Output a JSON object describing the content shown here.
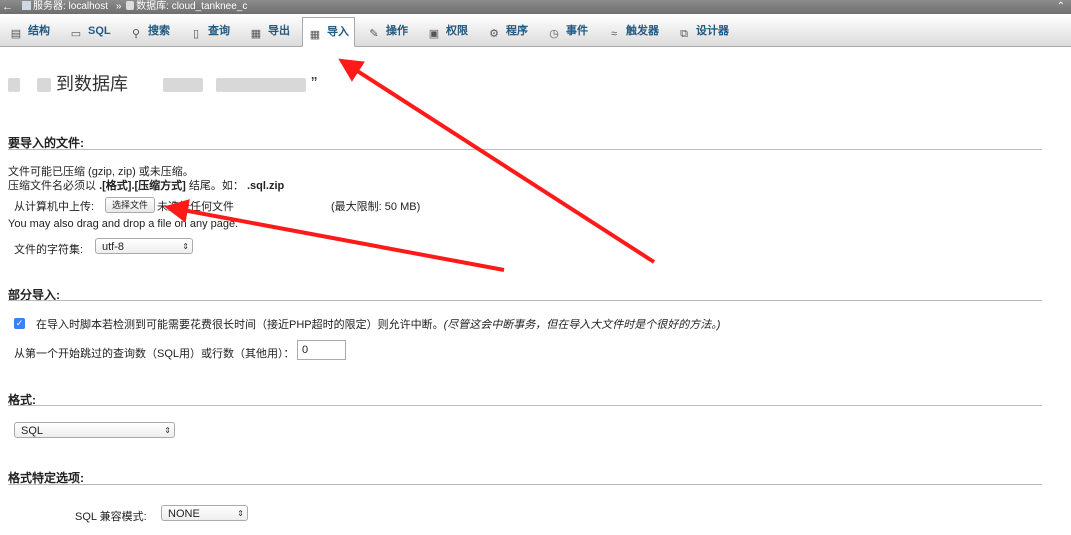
{
  "topbar": {
    "back_glyph": "←",
    "server_label": "服务器: localhost",
    "separator": "»",
    "database_label": "数据库: cloud_tanknee_c",
    "collapse_glyph": "⌃"
  },
  "tabs": [
    {
      "label": "结构",
      "icon": "structure-icon"
    },
    {
      "label": "SQL",
      "icon": "sql-icon"
    },
    {
      "label": "搜索",
      "icon": "search-icon"
    },
    {
      "label": "查询",
      "icon": "query-icon"
    },
    {
      "label": "导出",
      "icon": "export-icon"
    },
    {
      "label": "导入",
      "icon": "import-icon",
      "active": true
    },
    {
      "label": "操作",
      "icon": "wrench-icon"
    },
    {
      "label": "权限",
      "icon": "privileges-icon"
    },
    {
      "label": "程序",
      "icon": "routines-icon"
    },
    {
      "label": "事件",
      "icon": "clock-icon"
    },
    {
      "label": "触发器",
      "icon": "triggers-icon"
    },
    {
      "label": "设计器",
      "icon": "designer-icon"
    }
  ],
  "page": {
    "title_visible_text": "到数据库",
    "title_end_quote": "”"
  },
  "file_section": {
    "heading": "要导入的文件:",
    "line1": "文件可能已压缩 (gzip, zip) 或未压缩。",
    "line2_prefix": "压缩文件名必须以",
    "line2_bold": ".[格式].[压缩方式]",
    "line2_mid": "结尾。如：",
    "line2_example": ".sql.zip",
    "upload_label": "从计算机中上传:",
    "choose_file_button": "选择文件",
    "no_file_text": "未选择任何文件",
    "max_size": "(最大限制: 50 MB)",
    "drag_drop_text": "You may also drag and drop a file on any page.",
    "charset_label": "文件的字符集:",
    "charset_value": "utf-8"
  },
  "partial_section": {
    "heading": "部分导入:",
    "checkbox_checked": true,
    "checkbox_label": "在导入时脚本若检测到可能需要花费很长时间（接近PHP超时的限定）则允许中断。",
    "checkbox_note": "(尽管这会中断事务，但在导入大文件时是个很好的方法。)",
    "skip_label": "从第一个开始跳过的查询数（SQL用）或行数（其他用）：",
    "skip_value": "0"
  },
  "format_section": {
    "heading": "格式:",
    "format_value": "SQL"
  },
  "format_options_section": {
    "heading": "格式特定选项:",
    "compat_label": "SQL 兼容模式:",
    "compat_value": "NONE"
  },
  "colors": {
    "tab_text": "#235a81",
    "annotation_arrow": "#ff1a1a",
    "checkbox": "#3b82f6"
  }
}
